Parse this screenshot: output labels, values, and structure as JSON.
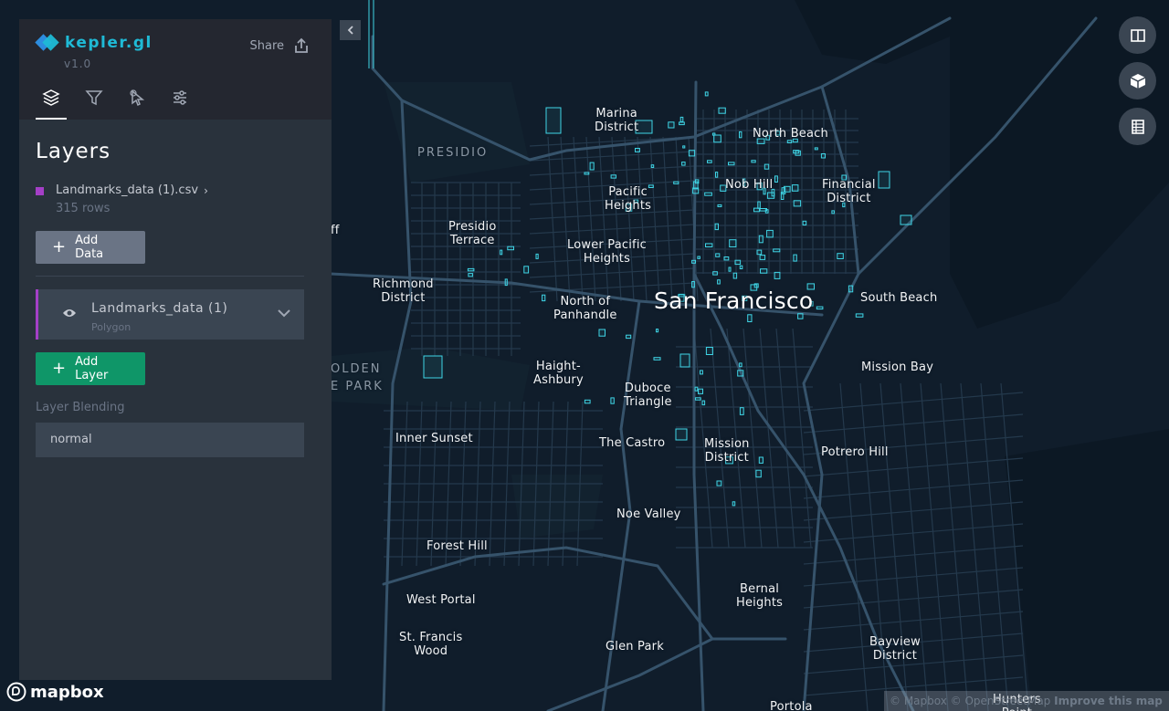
{
  "app": {
    "name": "kepler.gl",
    "version": "v1.0",
    "share_label": "Share"
  },
  "tabs": [
    {
      "name": "layers",
      "icon": "layers-icon",
      "active": true
    },
    {
      "name": "filters",
      "icon": "filter-icon",
      "active": false
    },
    {
      "name": "interactions",
      "icon": "cursor-icon",
      "active": false
    },
    {
      "name": "map-style",
      "icon": "settings-icon",
      "active": false
    }
  ],
  "panel": {
    "title": "Layers",
    "dataset": {
      "name": "Landmarks_data (1).csv",
      "rows": "315 rows",
      "color": "#a43fc7"
    },
    "add_data_label": "Add Data",
    "layer": {
      "name": "Landmarks_data (1)",
      "type": "Polygon",
      "color": "#a43fc7"
    },
    "add_layer_label": "Add Layer",
    "blending_label": "Layer Blending",
    "blending_value": "normal"
  },
  "map": {
    "labels": [
      {
        "id": "presidio",
        "text": "PRESIDIO",
        "kind": "park"
      },
      {
        "id": "marina",
        "text": "Marina\nDistrict",
        "kind": "normal"
      },
      {
        "id": "north-beach",
        "text": "North Beach",
        "kind": "normal"
      },
      {
        "id": "pacific-heights",
        "text": "Pacific\nHeights",
        "kind": "normal"
      },
      {
        "id": "nob-hill",
        "text": "Nob Hill",
        "kind": "normal"
      },
      {
        "id": "financial-district",
        "text": "Financial\nDistrict",
        "kind": "normal"
      },
      {
        "id": "presidio-terrace",
        "text": "Presidio\nTerrace",
        "kind": "normal"
      },
      {
        "id": "lower-pacific-heights",
        "text": "Lower Pacific\nHeights",
        "kind": "normal"
      },
      {
        "id": "richmond",
        "text": "Richmond\nDistrict",
        "kind": "normal"
      },
      {
        "id": "north-panhandle",
        "text": "North of\nPanhandle",
        "kind": "normal"
      },
      {
        "id": "san-francisco",
        "text": "San Francisco",
        "kind": "big"
      },
      {
        "id": "south-beach",
        "text": "South Beach",
        "kind": "normal"
      },
      {
        "id": "haight",
        "text": "Haight-\nAshbury",
        "kind": "normal"
      },
      {
        "id": "duboce",
        "text": "Duboce\nTriangle",
        "kind": "normal"
      },
      {
        "id": "mission-bay",
        "text": "Mission Bay",
        "kind": "normal"
      },
      {
        "id": "golden-gate",
        "text": "OLDEN",
        "kind": "park"
      },
      {
        "id": "golden-gate-park",
        "text": "E PARK",
        "kind": "park"
      },
      {
        "id": "inner-sunset",
        "text": "Inner Sunset",
        "kind": "normal"
      },
      {
        "id": "castro",
        "text": "The Castro",
        "kind": "normal"
      },
      {
        "id": "mission",
        "text": "Mission\nDistrict",
        "kind": "normal"
      },
      {
        "id": "potrero",
        "text": "Potrero Hill",
        "kind": "normal"
      },
      {
        "id": "noe-valley",
        "text": "Noe Valley",
        "kind": "normal"
      },
      {
        "id": "forest-hill",
        "text": "Forest Hill",
        "kind": "normal"
      },
      {
        "id": "bernal",
        "text": "Bernal\nHeights",
        "kind": "normal"
      },
      {
        "id": "west-portal",
        "text": "West Portal",
        "kind": "normal"
      },
      {
        "id": "st-francis",
        "text": "St. Francis\nWood",
        "kind": "normal"
      },
      {
        "id": "glen-park",
        "text": "Glen Park",
        "kind": "normal"
      },
      {
        "id": "bayview",
        "text": "Bayview\nDistrict",
        "kind": "normal"
      },
      {
        "id": "portola",
        "text": "Portola",
        "kind": "normal"
      },
      {
        "id": "hunters",
        "text": "Hunters\nPoint",
        "kind": "normal"
      },
      {
        "id": "cut-label",
        "text": "ff",
        "kind": "normal"
      }
    ],
    "polygon_color": "#3fd5e6",
    "road_color": "#2b4256"
  },
  "controls": [
    {
      "name": "split-map",
      "icon": "split-map-icon"
    },
    {
      "name": "3d-view",
      "icon": "cube-icon"
    },
    {
      "name": "legend",
      "icon": "legend-icon"
    }
  ],
  "mapbox_label": "mapbox",
  "attribution": {
    "text": "© Mapbox © OpenStreetMap",
    "improve": "Improve this map"
  }
}
